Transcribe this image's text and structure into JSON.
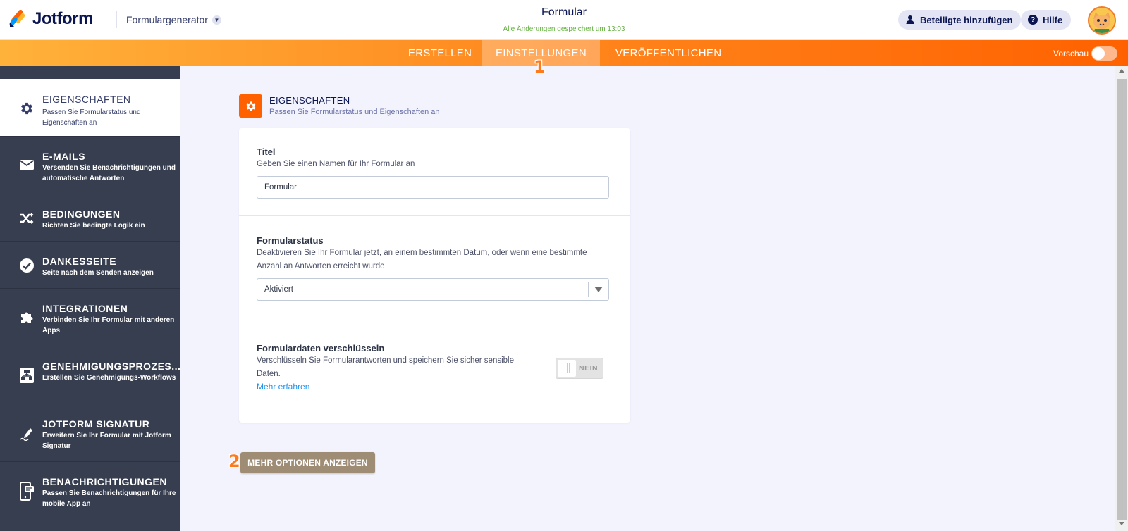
{
  "header": {
    "brand": "Jotform",
    "generator_label": "Formulargenerator",
    "form_title": "Formular",
    "save_status": "Alle Änderungen gespeichert um 13:03",
    "invite_label": "Beteiligte hinzufügen",
    "help_label": "Hilfe",
    "help_icon": "?"
  },
  "nav": {
    "tabs": [
      {
        "label": "ERSTELLEN"
      },
      {
        "label": "EINSTELLUNGEN"
      },
      {
        "label": "VERÖFFENTLICHEN"
      }
    ],
    "active_tab": "EINSTELLUNGEN",
    "preview_label": "Vorschau",
    "preview_enabled": false
  },
  "sidebar": {
    "items": [
      {
        "title": "EIGENSCHAFTEN",
        "desc": "Passen Sie Formularstatus und Eigenschaften an",
        "icon": "gear-icon",
        "active": true
      },
      {
        "title": "E-MAILS",
        "desc": "Versenden Sie Benachrichtigungen und automatische Antworten",
        "icon": "envelope-icon"
      },
      {
        "title": "BEDINGUNGEN",
        "desc": "Richten Sie bedingte Logik ein",
        "icon": "shuffle-icon"
      },
      {
        "title": "DANKESSEITE",
        "desc": "Seite nach dem Senden anzeigen",
        "icon": "check-circle-icon"
      },
      {
        "title": "INTEGRATIONEN",
        "desc": "Verbinden Sie Ihr Formular mit anderen Apps",
        "icon": "puzzle-icon"
      },
      {
        "title": "GENEHMIGUNGSPROZES...",
        "desc": "Erstellen Sie Genehmigungs-Workflows",
        "icon": "workflow-icon"
      },
      {
        "title": "JOTFORM SIGNATUR",
        "desc": "Erweitern Sie Ihr Formular mit Jotform Signatur",
        "icon": "pen-icon"
      },
      {
        "title": "BENACHRICHTIGUNGEN",
        "desc": "Passen Sie Benachrichtigungen für Ihre mobile App an",
        "icon": "mobile-notification-icon"
      }
    ]
  },
  "section": {
    "title": "EIGENSCHAFTEN",
    "desc": "Passen Sie Formularstatus und Eigenschaften an"
  },
  "fields": {
    "title": {
      "label": "Titel",
      "hint": "Geben Sie einen Namen für Ihr Formular an",
      "value": "Formular"
    },
    "status": {
      "label": "Formularstatus",
      "hint": "Deaktivieren Sie Ihr Formular jetzt, an einem bestimmten Datum, oder wenn eine bestimmte Anzahl an Antworten erreicht wurde",
      "value": "Aktiviert"
    },
    "encrypt": {
      "label": "Formulardaten verschlüsseln",
      "hint": "Verschlüsseln Sie Formularantworten und speichern Sie sicher sensible Daten.",
      "link": "Mehr erfahren",
      "toggle_label": "NEIN",
      "enabled": false
    }
  },
  "more_button": "MEHR OPTIONEN ANZEIGEN",
  "annotations": {
    "step1": "1",
    "step2": "2"
  },
  "colors": {
    "accent": "#ff6100",
    "nav_start": "#ffb23a",
    "sidebar": "#373e4f",
    "link": "#2493ed",
    "more_button": "#9f8c74",
    "saved": "#64b240"
  }
}
